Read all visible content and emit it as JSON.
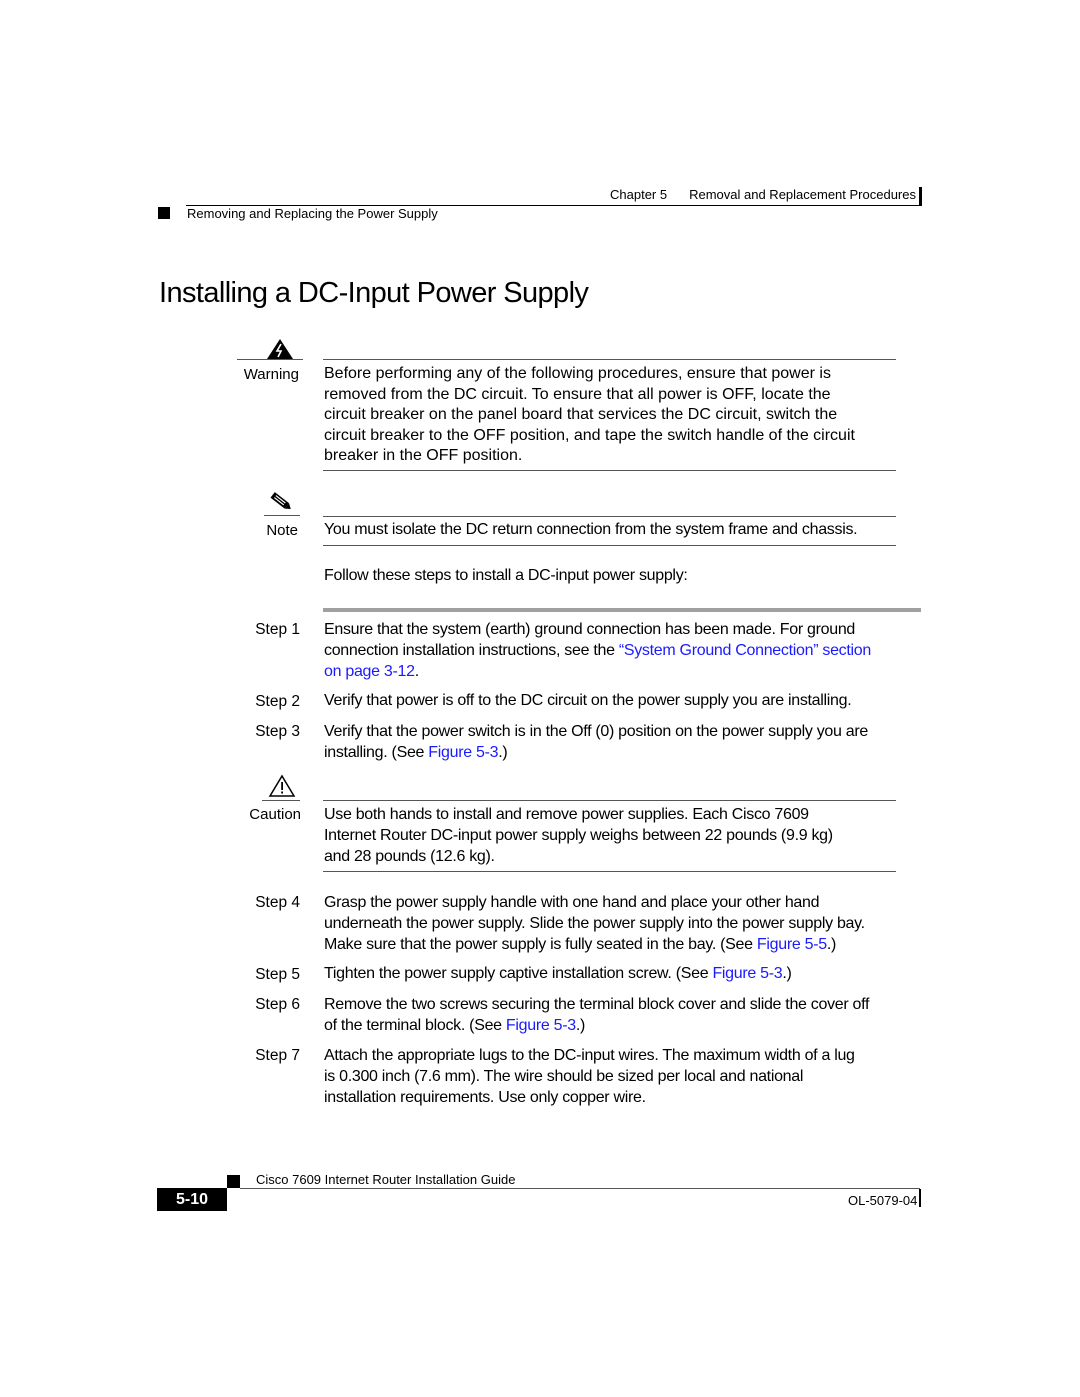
{
  "header": {
    "chapter": "Chapter 5",
    "chapter_title": "Removal and Replacement Procedures",
    "section": "Removing and Replacing the Power Supply"
  },
  "page_title": "Installing a DC-Input Power Supply",
  "warning": {
    "icon": "warning-electric-icon",
    "label": "Warning",
    "lines": [
      "Before performing any of the following procedures, ensure that power is",
      "removed from the DC circuit. To ensure that all power is OFF, locate the",
      "circuit breaker on the panel board that services the DC circuit, switch the",
      "circuit breaker to the OFF position, and tape the switch handle of the circuit",
      "breaker in the OFF position."
    ]
  },
  "note": {
    "icon": "pencil-note-icon",
    "label": "Note",
    "text": "You must isolate the DC return connection from the system frame and chassis."
  },
  "intro": "Follow these steps to install a DC-input power supply:",
  "steps": [
    {
      "label": "Step 1",
      "lines": [
        {
          "text": "Ensure that the system (earth) ground connection has been made. For ground"
        },
        {
          "text": "connection installation instructions, see the ",
          "link": "“System Ground Connection” section"
        },
        {
          "link": "on page 3-12",
          "after": "."
        }
      ]
    },
    {
      "label": "Step 2",
      "lines": [
        {
          "text": "Verify that power is off to the DC circuit on the power supply you are installing."
        }
      ]
    },
    {
      "label": "Step 3",
      "lines": [
        {
          "text": "Verify that the power switch is in the Off (0) position on the power supply you are"
        },
        {
          "text": "installing. (See ",
          "link": "Figure 5-3",
          "after": ".)"
        }
      ]
    },
    {
      "label": "Step 4",
      "lines": [
        {
          "text": "Grasp the power supply handle with one hand and place your other hand"
        },
        {
          "text": "underneath the power supply. Slide the power supply into the power supply bay."
        },
        {
          "text": "Make sure that the power supply is fully seated in the bay. (See ",
          "link": "Figure 5-5",
          "after": ".)"
        }
      ]
    },
    {
      "label": "Step 5",
      "lines": [
        {
          "text": "Tighten the power supply captive installation screw. (See ",
          "link": "Figure 5-3",
          "after": ".)"
        }
      ]
    },
    {
      "label": "Step 6",
      "lines": [
        {
          "text": "Remove the two screws securing the terminal block cover and slide the cover off"
        },
        {
          "text": "of the terminal block. (See ",
          "link": "Figure 5-3",
          "after": ".)"
        }
      ]
    },
    {
      "label": "Step 7",
      "lines": [
        {
          "text": "Attach the appropriate lugs to the DC-input wires. The maximum width of a lug"
        },
        {
          "text": "is 0.300 inch (7.6 mm). The wire should be sized per local and national"
        },
        {
          "text": "installation requirements. Use only copper wire."
        }
      ]
    }
  ],
  "caution": {
    "icon": "caution-triangle-icon",
    "label": "Caution",
    "lines": [
      "Use both hands to install and remove power supplies. Each Cisco 7609",
      "Internet Router DC-input power supply weighs between 22 pounds (9.9 kg)",
      "and 28 pounds (12.6 kg)."
    ]
  },
  "footer": {
    "guide_title": "Cisco 7609 Internet Router Installation Guide",
    "page_number": "5-10",
    "doc_number": "OL-5079-04"
  },
  "colors": {
    "link": "#1a1aff",
    "text": "#000000",
    "thick_rule": "#a0a0a0"
  }
}
